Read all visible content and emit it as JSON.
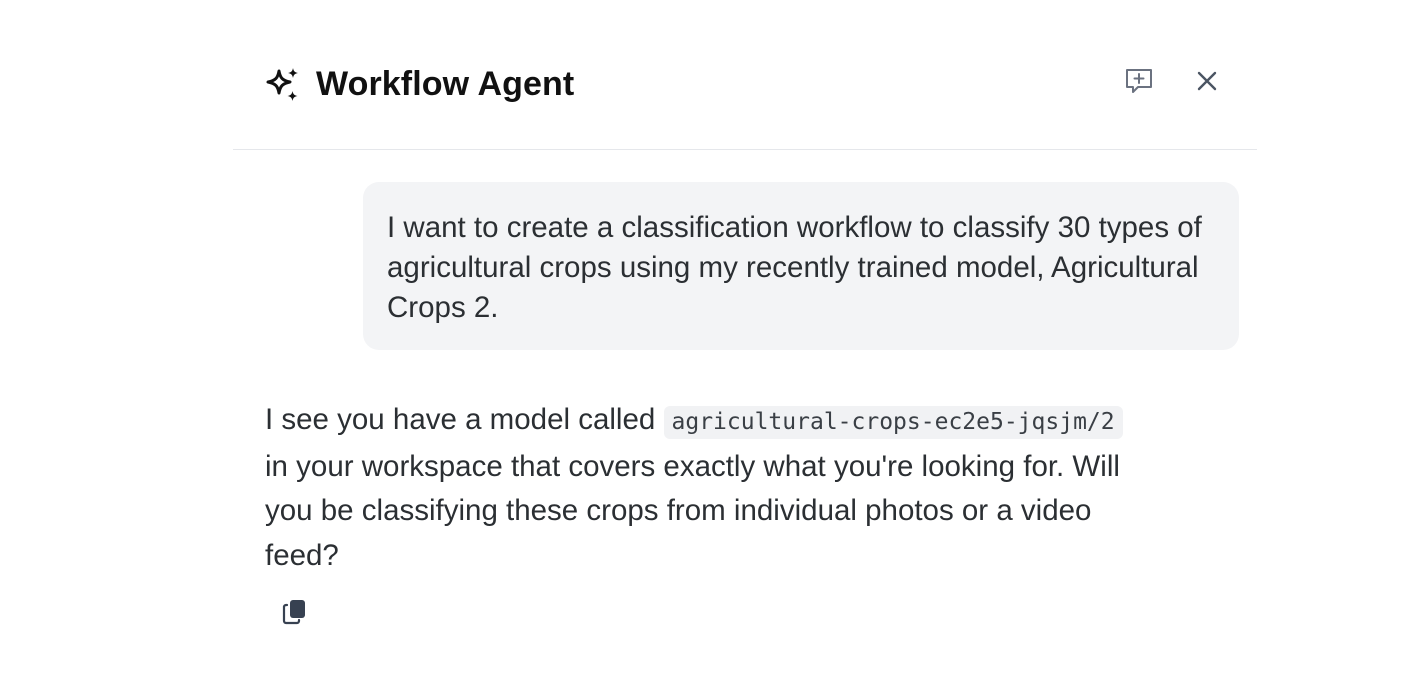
{
  "header": {
    "title": "Workflow Agent",
    "icons": {
      "title_icon": "sparkle-icon",
      "new_chat": "new-chat-icon",
      "close": "close-icon"
    }
  },
  "conversation": {
    "user_message": "I want to create a classification workflow to classify 30 types of agricultural crops using my recently trained model, Agricultural Crops 2.",
    "agent_message": {
      "text_before": "I see you have a model called ",
      "code": "agricultural-crops-ec2e5-jqsjm/2",
      "text_after": " in your workspace that covers exactly what you're looking for. Will you be classifying these crops from individual photos or a video feed?"
    },
    "actions": {
      "copy_icon": "copy-icon"
    }
  },
  "colors": {
    "bubble_bg": "#f3f4f6",
    "divider": "#e5e7eb",
    "text": "#2b2f33",
    "icon_muted": "#6b7280"
  }
}
